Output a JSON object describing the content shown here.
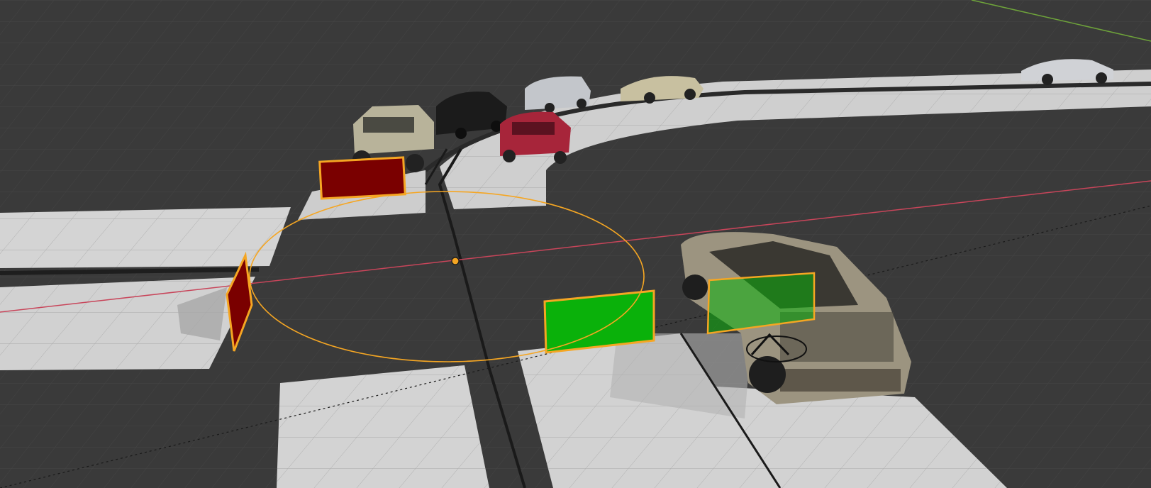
{
  "viewport": {
    "background": "#3a3a3a",
    "grid_color": "#474747",
    "pavement_color": "#cfcfcf",
    "pavement_shade": "#b9b9b9",
    "x_axis_color": "#c8455a",
    "y_axis_color": "#6ea33a",
    "selection_color": "#f5a623",
    "signal_red": "#7a0000",
    "signal_green": "#0ab10a"
  },
  "objects": [
    {
      "name": "jeep",
      "color": "#b8b39a"
    },
    {
      "name": "black-sedan",
      "color": "#1b1b1b"
    },
    {
      "name": "silver-hatchback",
      "color": "#c3c6cb"
    },
    {
      "name": "gold-supercar",
      "color": "#c8c0a0"
    },
    {
      "name": "red-hatchback",
      "color": "#a7253a"
    },
    {
      "name": "silver-supercar-far",
      "color": "#d0d2d6"
    },
    {
      "name": "suv",
      "color": "#9c9480"
    }
  ]
}
